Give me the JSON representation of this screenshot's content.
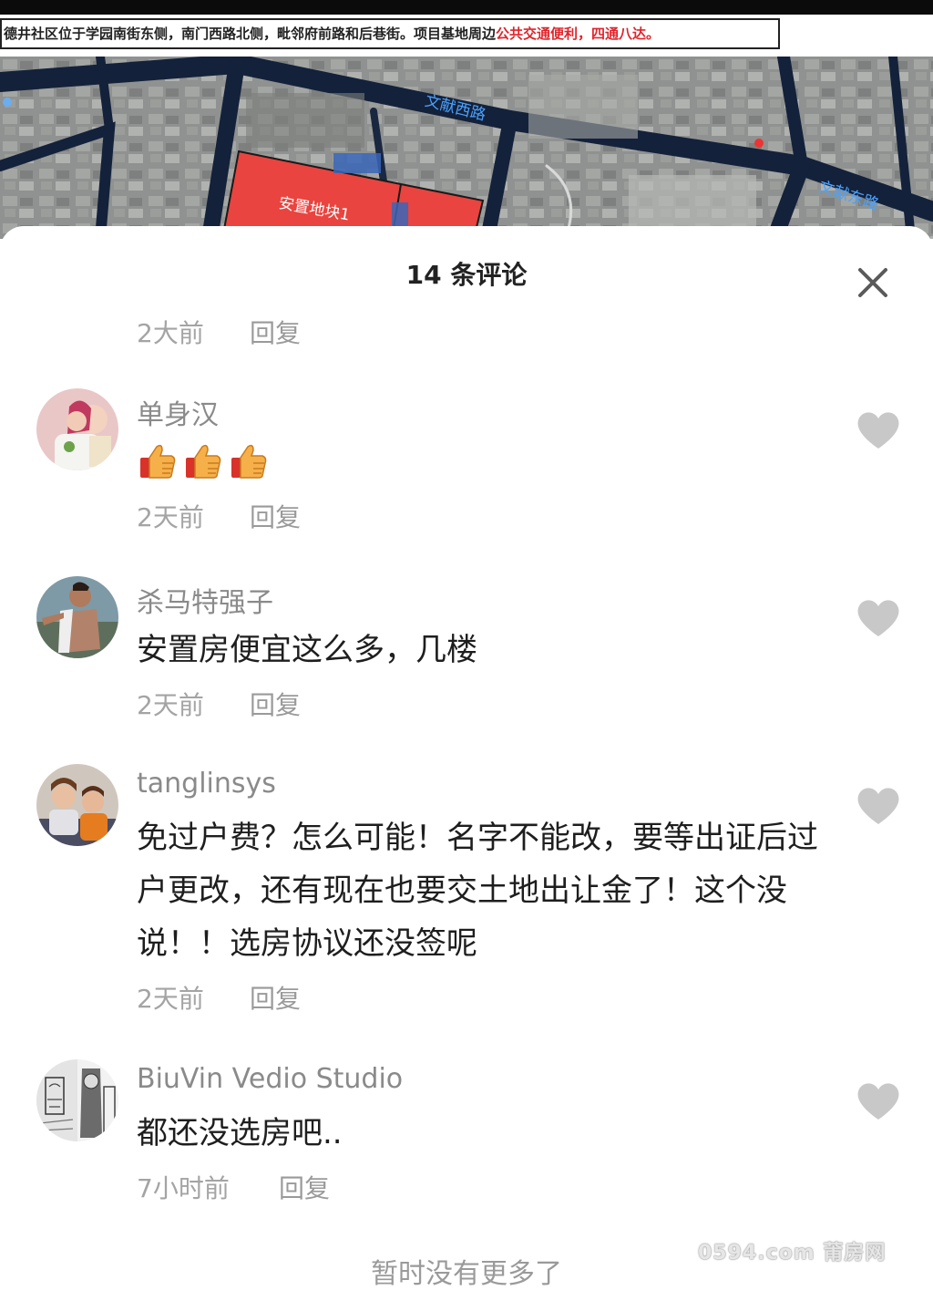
{
  "map": {
    "caption_text": "德井社区位于学园南街东侧，南门西路北侧，毗邻府前路和后巷街。项目基地周边",
    "caption_highlight": "公共交通便利，四通八达。",
    "road_label_1": "文献西路",
    "road_label_2": "文献东路",
    "plot_label": "安置地块1"
  },
  "sheet": {
    "title": "14 条评论",
    "close_icon": "close-icon"
  },
  "partial_comment": {
    "time": "2大前",
    "reply": "回复"
  },
  "comments": [
    {
      "username": "单身汉",
      "text": "",
      "emoji": "thumbs-up x3",
      "time": "2天前",
      "reply": "回复"
    },
    {
      "username": "杀马特强子",
      "text": "安置房便宜这么多，几楼",
      "time": "2天前",
      "reply": "回复"
    },
    {
      "username": "tanglinsys",
      "text": "免过户费？怎么可能！名字不能改，要等出证后过户更改，还有现在也要交土地出让金了！这个没说！！选房协议还没签呢",
      "time": "2天前",
      "reply": "回复"
    },
    {
      "username": "BiuVin Vedio Studio",
      "text": "都还没选房吧..",
      "time": "7小时前",
      "reply": "回复"
    }
  ],
  "footer": {
    "message": "暂时没有更多了",
    "watermark": "0594.com 莆房网"
  },
  "colors": {
    "like_icon": "#c8c8c8",
    "meta_text": "#a4a4a4",
    "highlight_red": "#e0242b",
    "map_plot_red": "#e9443f"
  }
}
